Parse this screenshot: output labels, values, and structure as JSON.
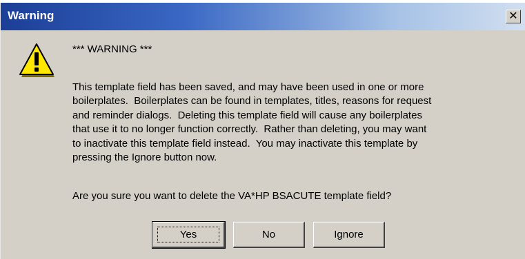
{
  "window": {
    "title": "Warning",
    "close_glyph": "✕",
    "colors": {
      "title_start": "#1b3e96",
      "title_end": "#d2dff0",
      "face": "#d4d0c8"
    }
  },
  "dialog": {
    "icon": "warning-triangle-icon",
    "heading": "*** WARNING ***",
    "message": "This template field has been saved, and may have been used in one or more\nboilerplates.  Boilerplates can be found in templates, titles, reasons for request\nand reminder dialogs.  Deleting this template field will cause any boilerplates\nthat use it to no longer function correctly.  Rather than deleting, you may want\nto inactivate this template field instead.  You may inactivate this template by\npressing the Ignore button now.",
    "question": "Are you sure you want to delete the VA*HP BSACUTE template field?"
  },
  "buttons": {
    "yes_label": "Yes",
    "no_label": "No",
    "ignore_label": "Ignore",
    "default": "yes"
  }
}
